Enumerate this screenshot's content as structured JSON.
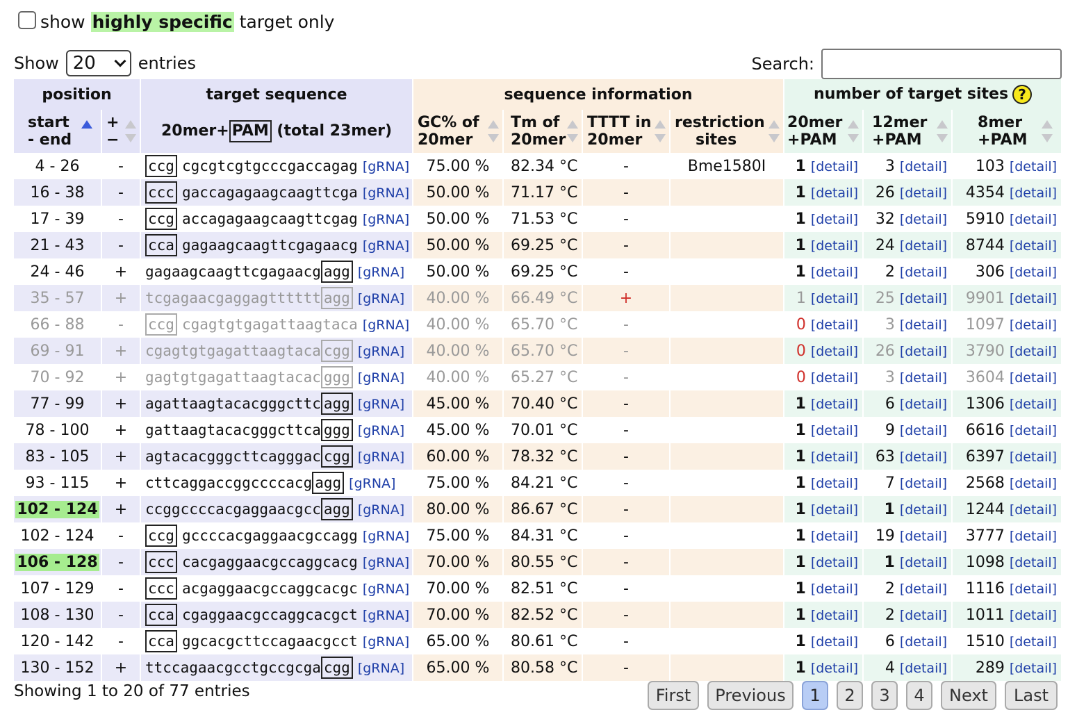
{
  "filter": {
    "prefix": "show",
    "highlight": "highly specific",
    "suffix": "target only"
  },
  "length": {
    "show": "Show",
    "value": "20",
    "entries": "entries"
  },
  "search": {
    "label": "Search:",
    "value": ""
  },
  "headers": {
    "group_position": "position",
    "group_target": "target sequence",
    "group_seqinfo": "sequence information",
    "group_sites": "number of target sites",
    "help_icon": "?",
    "start_end_1": "start",
    "start_end_2": "- end",
    "strand_1": "+",
    "strand_2": "−",
    "seq_1": "20mer+",
    "seq_pam": "PAM",
    "seq_2": " (total 23mer)",
    "gc_1": "GC% of",
    "gc_2": "20mer",
    "tm_1": "Tm of",
    "tm_2": "20mer",
    "tttt_1": "TTTT in",
    "tttt_2": "20mer",
    "re_1": "restriction",
    "re_2": "sites",
    "s20_1": "20mer",
    "s20_2": "+PAM",
    "s12_1": "12mer",
    "s12_2": "+PAM",
    "s8_1": "8mer",
    "s8_2": "+PAM"
  },
  "link_grna": "[gRNA]",
  "link_detail": "[detail]",
  "rows": [
    {
      "pos": "4 - 26",
      "strand": "-",
      "pam": "ccg",
      "seq": "cgcgtcgtgcccgaccagag",
      "gc": "75.00 %",
      "tm": "82.34 °C",
      "tttt": "-",
      "re": "Bme1580I",
      "n20": "1",
      "n12": "3",
      "n8": "103",
      "faded": false,
      "hl": false
    },
    {
      "pos": "16 - 38",
      "strand": "-",
      "pam": "ccc",
      "seq": "gaccagagaagcaagttcga",
      "gc": "50.00 %",
      "tm": "71.17 °C",
      "tttt": "-",
      "re": "",
      "n20": "1",
      "n12": "26",
      "n8": "4354",
      "faded": false,
      "hl": false
    },
    {
      "pos": "17 - 39",
      "strand": "-",
      "pam": "ccg",
      "seq": "accagagaagcaagttcgag",
      "gc": "50.00 %",
      "tm": "71.53 °C",
      "tttt": "-",
      "re": "",
      "n20": "1",
      "n12": "32",
      "n8": "5910",
      "faded": false,
      "hl": false
    },
    {
      "pos": "21 - 43",
      "strand": "-",
      "pam": "cca",
      "seq": "gagaagcaagttcgagaacg",
      "gc": "50.00 %",
      "tm": "69.25 °C",
      "tttt": "-",
      "re": "",
      "n20": "1",
      "n12": "24",
      "n8": "8744",
      "faded": false,
      "hl": false
    },
    {
      "pos": "24 - 46",
      "strand": "+",
      "pam": "agg",
      "seq": "gagaagcaagttcgagaacg",
      "gc": "50.00 %",
      "tm": "69.25 °C",
      "tttt": "-",
      "re": "",
      "n20": "1",
      "n12": "2",
      "n8": "306",
      "faded": false,
      "hl": false
    },
    {
      "pos": "35 - 57",
      "strand": "+",
      "pam": "agg",
      "seq": "tcgagaacgaggagtttttt",
      "gc": "40.00 %",
      "tm": "66.49 °C",
      "tttt": "+",
      "re": "",
      "n20": "1",
      "n12": "25",
      "n8": "9901",
      "faded": true,
      "hl": false
    },
    {
      "pos": "66 - 88",
      "strand": "-",
      "pam": "ccg",
      "seq": "cgagtgtgagattaagtaca",
      "gc": "40.00 %",
      "tm": "65.70 °C",
      "tttt": "-",
      "re": "",
      "n20": "0",
      "n12": "3",
      "n8": "1097",
      "faded": true,
      "hl": false
    },
    {
      "pos": "69 - 91",
      "strand": "+",
      "pam": "cgg",
      "seq": "cgagtgtgagattaagtaca",
      "gc": "40.00 %",
      "tm": "65.70 °C",
      "tttt": "-",
      "re": "",
      "n20": "0",
      "n12": "26",
      "n8": "3790",
      "faded": true,
      "hl": false
    },
    {
      "pos": "70 - 92",
      "strand": "+",
      "pam": "ggg",
      "seq": "gagtgtgagattaagtacac",
      "gc": "40.00 %",
      "tm": "65.27 °C",
      "tttt": "-",
      "re": "",
      "n20": "0",
      "n12": "3",
      "n8": "3604",
      "faded": true,
      "hl": false
    },
    {
      "pos": "77 - 99",
      "strand": "+",
      "pam": "agg",
      "seq": "agattaagtacacgggcttc",
      "gc": "45.00 %",
      "tm": "70.40 °C",
      "tttt": "-",
      "re": "",
      "n20": "1",
      "n12": "6",
      "n8": "1306",
      "faded": false,
      "hl": false
    },
    {
      "pos": "78 - 100",
      "strand": "+",
      "pam": "ggg",
      "seq": "gattaagtacacgggcttca",
      "gc": "45.00 %",
      "tm": "70.01 °C",
      "tttt": "-",
      "re": "",
      "n20": "1",
      "n12": "9",
      "n8": "6616",
      "faded": false,
      "hl": false
    },
    {
      "pos": "83 - 105",
      "strand": "+",
      "pam": "cgg",
      "seq": "agtacacgggcttcagggac",
      "gc": "60.00 %",
      "tm": "78.32 °C",
      "tttt": "-",
      "re": "",
      "n20": "1",
      "n12": "63",
      "n8": "6397",
      "faded": false,
      "hl": false
    },
    {
      "pos": "93 - 115",
      "strand": "+",
      "pam": "agg",
      "seq": "cttcaggaccggccccacg",
      "gc": "75.00 %",
      "tm": "84.21 °C",
      "tttt": "-",
      "re": "",
      "n20": "1",
      "n12": "7",
      "n8": "2568",
      "faded": false,
      "hl": false
    },
    {
      "pos": "102 - 124",
      "strand": "+",
      "pam": "agg",
      "seq": "ccggccccacgaggaacgcc",
      "gc": "80.00 %",
      "tm": "86.67 °C",
      "tttt": "-",
      "re": "",
      "n20": "1",
      "n12": "1",
      "n8": "1244",
      "faded": false,
      "hl": true
    },
    {
      "pos": "102 - 124",
      "strand": "-",
      "pam": "ccg",
      "seq": "gccccacgaggaacgccagg",
      "gc": "75.00 %",
      "tm": "84.31 °C",
      "tttt": "-",
      "re": "",
      "n20": "1",
      "n12": "19",
      "n8": "3777",
      "faded": false,
      "hl": false
    },
    {
      "pos": "106 - 128",
      "strand": "-",
      "pam": "ccc",
      "seq": "cacgaggaacgccaggcacg",
      "gc": "70.00 %",
      "tm": "80.55 °C",
      "tttt": "-",
      "re": "",
      "n20": "1",
      "n12": "1",
      "n8": "1098",
      "faded": false,
      "hl": true
    },
    {
      "pos": "107 - 129",
      "strand": "-",
      "pam": "ccc",
      "seq": "acgaggaacgccaggcacgc",
      "gc": "70.00 %",
      "tm": "82.51 °C",
      "tttt": "-",
      "re": "",
      "n20": "1",
      "n12": "2",
      "n8": "1116",
      "faded": false,
      "hl": false
    },
    {
      "pos": "108 - 130",
      "strand": "-",
      "pam": "cca",
      "seq": "cgaggaacgccaggcacgct",
      "gc": "70.00 %",
      "tm": "82.52 °C",
      "tttt": "-",
      "re": "",
      "n20": "1",
      "n12": "2",
      "n8": "1011",
      "faded": false,
      "hl": false
    },
    {
      "pos": "120 - 142",
      "strand": "-",
      "pam": "cca",
      "seq": "ggcacgcttccagaacgcct",
      "gc": "65.00 %",
      "tm": "80.61 °C",
      "tttt": "-",
      "re": "",
      "n20": "1",
      "n12": "6",
      "n8": "1510",
      "faded": false,
      "hl": false
    },
    {
      "pos": "130 - 152",
      "strand": "+",
      "pam": "cgg",
      "seq": "ttccagaacgcctgccgcga",
      "gc": "65.00 %",
      "tm": "80.58 °C",
      "tttt": "-",
      "re": "",
      "n20": "1",
      "n12": "4",
      "n8": "289",
      "faded": false,
      "hl": false
    }
  ],
  "info": "Showing 1 to 20 of 77 entries",
  "pager": {
    "first": "First",
    "previous": "Previous",
    "pages": [
      "1",
      "2",
      "3",
      "4"
    ],
    "next": "Next",
    "last": "Last"
  }
}
